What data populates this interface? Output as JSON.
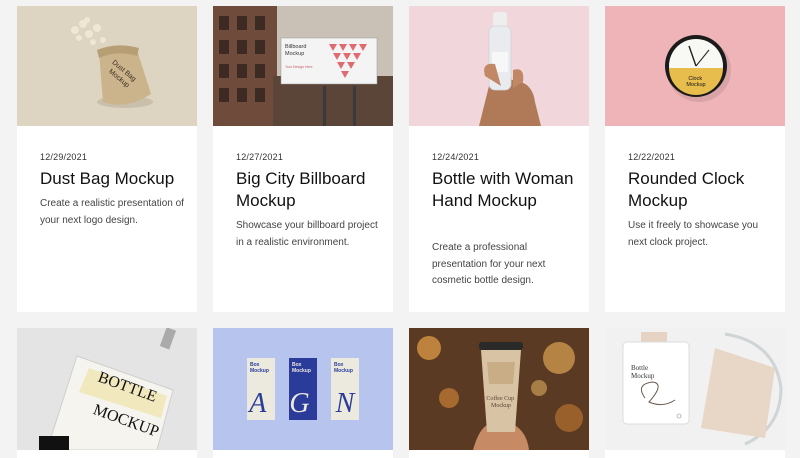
{
  "cards": [
    {
      "date": "12/29/2021",
      "title": "Dust Bag Mockup",
      "description": "Create a realistic presentation of your next logo design.",
      "image_text": [
        "Dust Bag",
        "Mockup"
      ]
    },
    {
      "date": "12/27/2021",
      "title": "Big City Billboard Mockup",
      "description": "Showcase your billboard project in a realistic environment.",
      "image_text": [
        "Billboard",
        "Mockup",
        "Your",
        "Design",
        "Here"
      ]
    },
    {
      "date": "12/24/2021",
      "title": "Bottle with Woman Hand Mockup",
      "description": "Create a professional presentation for your next cosmetic bottle design."
    },
    {
      "date": "12/22/2021",
      "title": "Rounded Clock Mockup",
      "description": "Use it freely to showcase you next clock project.",
      "image_text": [
        "Clock",
        "Mockup"
      ]
    },
    {
      "image_text": [
        "BOTTLE",
        "MOCKUP"
      ]
    },
    {
      "image_text": [
        "Box",
        "Mockup",
        "A",
        "G",
        "N"
      ]
    },
    {
      "image_text": [
        "Coffee Cup",
        "Mockup"
      ]
    },
    {
      "image_text": [
        "Bottle",
        "Mockup"
      ]
    }
  ],
  "colors": {
    "page_background": "#f3f3f3",
    "card_background": "#ffffff",
    "clock_background": "#eeb4b7",
    "box_background": "#b7c4ee"
  }
}
